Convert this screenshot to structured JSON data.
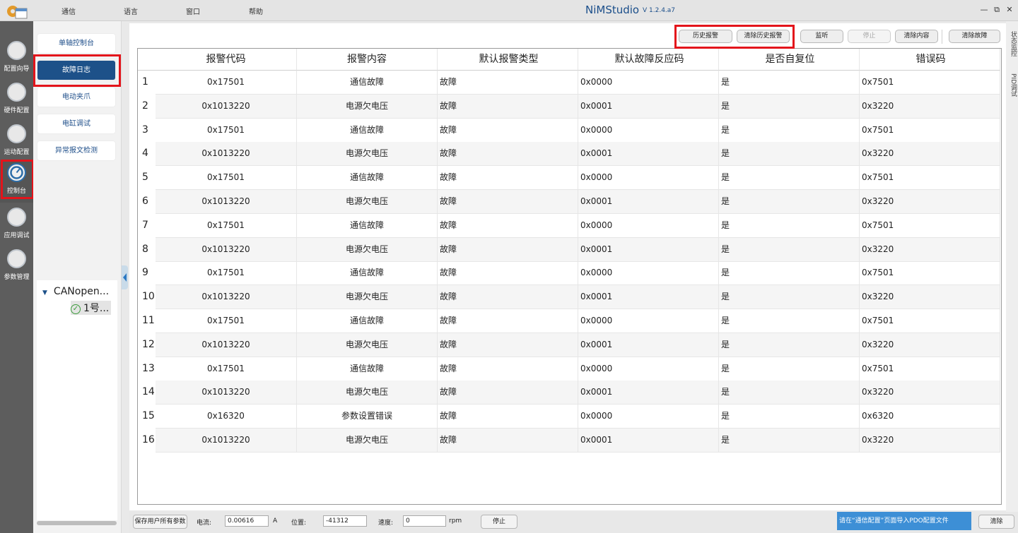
{
  "menu": {
    "items": [
      "通信",
      "语言",
      "窗口",
      "帮助"
    ]
  },
  "app": {
    "title": "NiMStudio",
    "version": "V 1.2.4.a7"
  },
  "sidebar": {
    "items": [
      {
        "label": "配置向导",
        "icon": "config-wizard-icon"
      },
      {
        "label": "硬件配置",
        "icon": "hardware-config-icon"
      },
      {
        "label": "运动配置",
        "icon": "motion-config-icon"
      },
      {
        "label": "控制台",
        "icon": "console-gauge-icon"
      },
      {
        "label": "应用调试",
        "icon": "app-debug-icon"
      },
      {
        "label": "参数管理",
        "icon": "param-manage-icon"
      }
    ],
    "active_index": 3
  },
  "subnav": {
    "items": [
      "单轴控制台",
      "故障日志",
      "电动夹爪",
      "电缸调试",
      "异常报文检测"
    ],
    "active_index": 1
  },
  "tree": {
    "root": "CANopen...",
    "child": "1号..."
  },
  "toolbar": {
    "history_alarm": "历史报警",
    "clear_history_alarm": "清除历史报警",
    "monitor": "监听",
    "stop": "停止",
    "clear_content": "清除内容",
    "clear_fault": "清除故障"
  },
  "table": {
    "columns": [
      "报警代码",
      "报警内容",
      "默认报警类型",
      "默认故障反应码",
      "是否自复位",
      "错误码"
    ],
    "rows": [
      [
        "1",
        "0x17501",
        "通信故障",
        "故障",
        "0x0000",
        "是",
        "0x7501"
      ],
      [
        "2",
        "0x1013220",
        "电源欠电压",
        "故障",
        "0x0001",
        "是",
        "0x3220"
      ],
      [
        "3",
        "0x17501",
        "通信故障",
        "故障",
        "0x0000",
        "是",
        "0x7501"
      ],
      [
        "4",
        "0x1013220",
        "电源欠电压",
        "故障",
        "0x0001",
        "是",
        "0x3220"
      ],
      [
        "5",
        "0x17501",
        "通信故障",
        "故障",
        "0x0000",
        "是",
        "0x7501"
      ],
      [
        "6",
        "0x1013220",
        "电源欠电压",
        "故障",
        "0x0001",
        "是",
        "0x3220"
      ],
      [
        "7",
        "0x17501",
        "通信故障",
        "故障",
        "0x0000",
        "是",
        "0x7501"
      ],
      [
        "8",
        "0x1013220",
        "电源欠电压",
        "故障",
        "0x0001",
        "是",
        "0x3220"
      ],
      [
        "9",
        "0x17501",
        "通信故障",
        "故障",
        "0x0000",
        "是",
        "0x7501"
      ],
      [
        "10",
        "0x1013220",
        "电源欠电压",
        "故障",
        "0x0001",
        "是",
        "0x3220"
      ],
      [
        "11",
        "0x17501",
        "通信故障",
        "故障",
        "0x0000",
        "是",
        "0x7501"
      ],
      [
        "12",
        "0x1013220",
        "电源欠电压",
        "故障",
        "0x0001",
        "是",
        "0x3220"
      ],
      [
        "13",
        "0x17501",
        "通信故障",
        "故障",
        "0x0000",
        "是",
        "0x7501"
      ],
      [
        "14",
        "0x1013220",
        "电源欠电压",
        "故障",
        "0x0001",
        "是",
        "0x3220"
      ],
      [
        "15",
        "0x16320",
        "参数设置错误",
        "故障",
        "0x0000",
        "是",
        "0x6320"
      ],
      [
        "16",
        "0x1013220",
        "电源欠电压",
        "故障",
        "0x0001",
        "是",
        "0x3220"
      ]
    ]
  },
  "right_tabs": [
    "状态监控",
    "PID调试"
  ],
  "statusbar": {
    "save_all": "保存用户所有参数",
    "current_label": "电流:",
    "current_value": "0.00616",
    "current_unit": "A",
    "position_label": "位置:",
    "position_value": "-41312",
    "speed_label": "速度:",
    "speed_value": "0",
    "speed_unit": "rpm",
    "stop": "停止",
    "message": "请在“通信配置”页面导入PDO配置文件",
    "clear": "清除"
  },
  "colors": {
    "accent": "#1d5189",
    "highlight_box": "#e3141b",
    "status_msg_bg": "#3d8fd6"
  }
}
